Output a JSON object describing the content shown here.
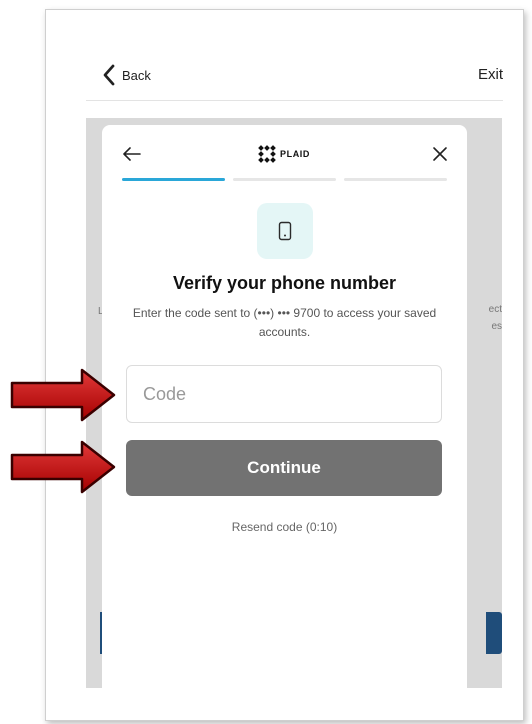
{
  "header": {
    "back_label": "Back",
    "exit_label": "Exit"
  },
  "background": {
    "left_fragment": "L",
    "right_fragment_1": "ect",
    "right_fragment_2": "es"
  },
  "modal": {
    "brand": "PLAID",
    "progress_segments": 3,
    "active_segment": 1,
    "title": "Verify your phone number",
    "subtitle": "Enter the code sent to (•••) ••• 9700 to access your saved accounts.",
    "code_placeholder": "Code",
    "continue_label": "Continue",
    "resend_label": "Resend code (0:10)"
  },
  "colors": {
    "progress_active": "#2aa7d8",
    "continue_bg": "#727272",
    "annotation_arrow": "#c00000",
    "phone_tile_bg": "#e4f6f6",
    "background_button": "#1f4d7a"
  },
  "icons": {
    "back": "chevron-left-icon",
    "modal_back": "arrow-left-icon",
    "close": "close-icon",
    "brand": "plaid-logo-icon",
    "phone": "phone-icon",
    "annotation": "red-arrow-icon"
  }
}
